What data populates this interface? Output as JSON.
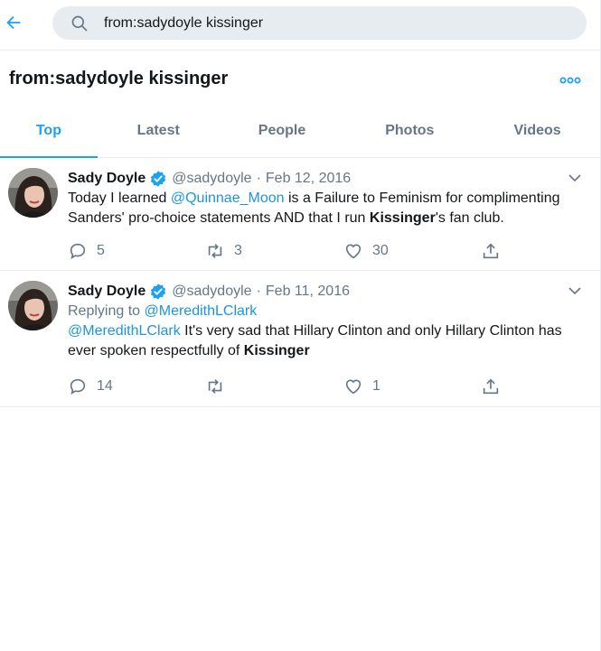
{
  "search": {
    "query": "from:sadydoyle kissinger"
  },
  "header": {
    "title": "from:sadydoyle kissinger"
  },
  "tabs": [
    {
      "label": "Top",
      "active": true
    },
    {
      "label": "Latest",
      "active": false
    },
    {
      "label": "People",
      "active": false
    },
    {
      "label": "Photos",
      "active": false
    },
    {
      "label": "Videos",
      "active": false
    }
  ],
  "tweets": [
    {
      "name": "Sady Doyle",
      "handle": "@sadydoyle",
      "separator": "·",
      "date": "Feb 12, 2016",
      "text": {
        "part1": "Today I learned ",
        "mention": "@Quinnae_Moon",
        "part2": " is a Failure to Feminism for complimenting Sanders' pro-choice statements AND that I run ",
        "keyword": "Kissinger",
        "part3": "'s fan club."
      },
      "replies": "5",
      "retweets": "3",
      "likes": "30"
    },
    {
      "name": "Sady Doyle",
      "handle": "@sadydoyle",
      "separator": "·",
      "date": "Feb 11, 2016",
      "replying_prefix": "Replying to ",
      "replying_to": "@MeredithLClark",
      "text": {
        "mention": "@MeredithLClark",
        "part1": " It's very sad that Hillary Clinton and only Hillary Clinton has ever spoken respectfully of ",
        "keyword": "Kissinger"
      },
      "replies": "14",
      "retweets": "",
      "likes": "1"
    }
  ],
  "colors": {
    "accent": "#1da1f2",
    "link": "#1b95e0",
    "muted": "#657786"
  },
  "icons": [
    "back-arrow-icon",
    "search-icon",
    "more-icon",
    "verified-badge-icon",
    "chevron-down-icon",
    "reply-icon",
    "retweet-icon",
    "like-icon",
    "share-icon"
  ]
}
